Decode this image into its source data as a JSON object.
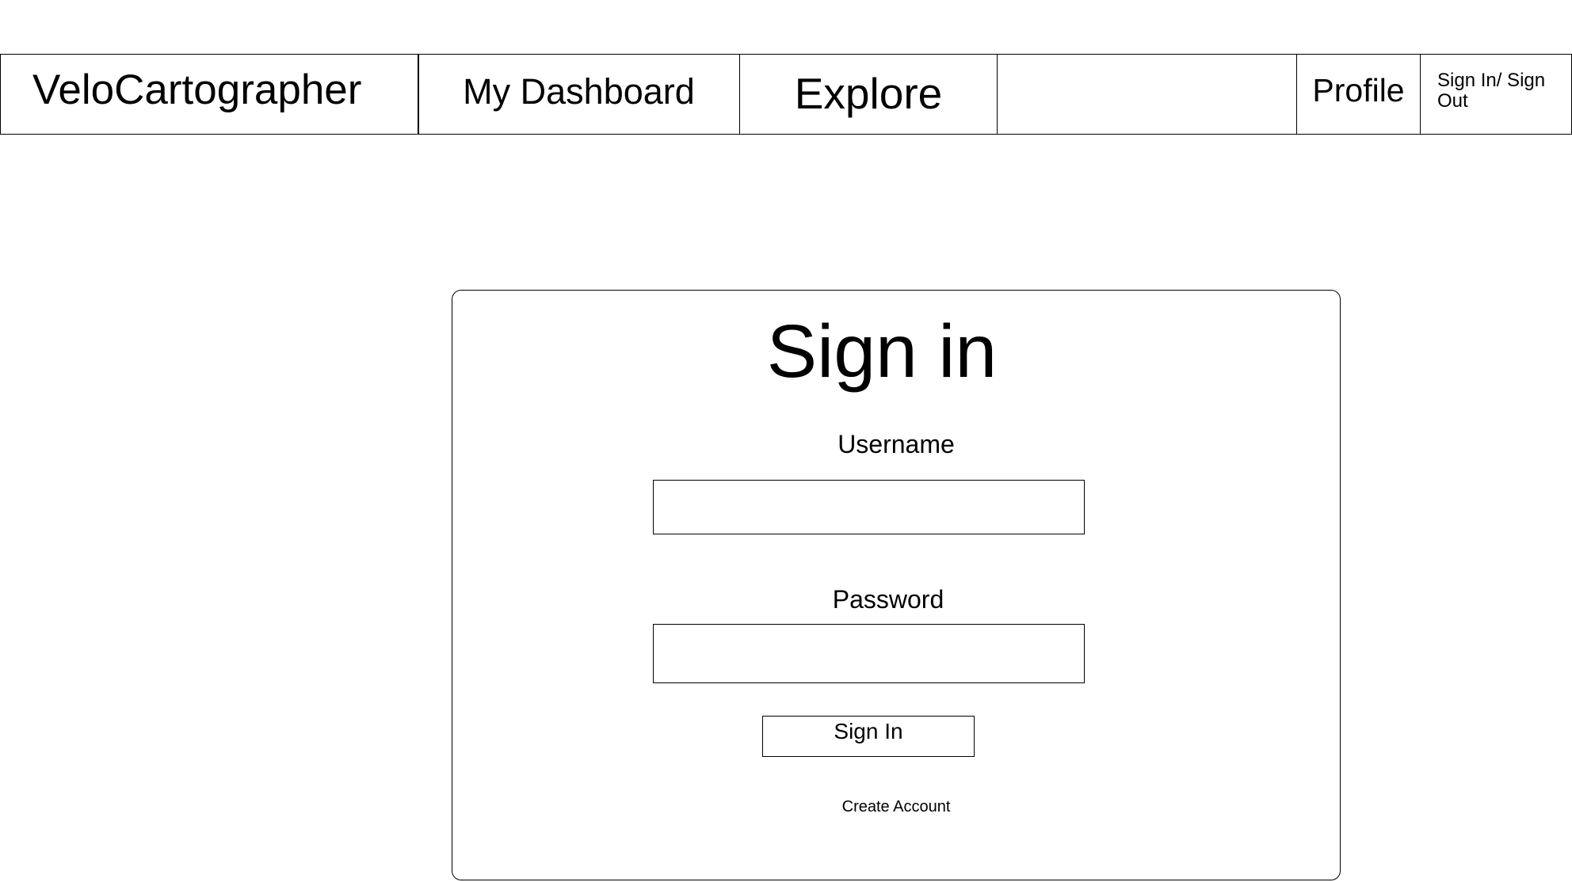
{
  "nav": {
    "brand": "VeloCartographer",
    "dashboard": "My Dashboard",
    "explore": "Explore",
    "profile": "Profile",
    "sign_in_out": "Sign In/ Sign Out"
  },
  "signin": {
    "title": "Sign in",
    "username_label": "Username",
    "username_value": "",
    "password_label": "Password",
    "password_value": "",
    "button_label": "Sign In",
    "create_account": "Create Account"
  },
  "colors": {
    "border": "#000000",
    "background": "#ffffff",
    "text": "#000000"
  }
}
